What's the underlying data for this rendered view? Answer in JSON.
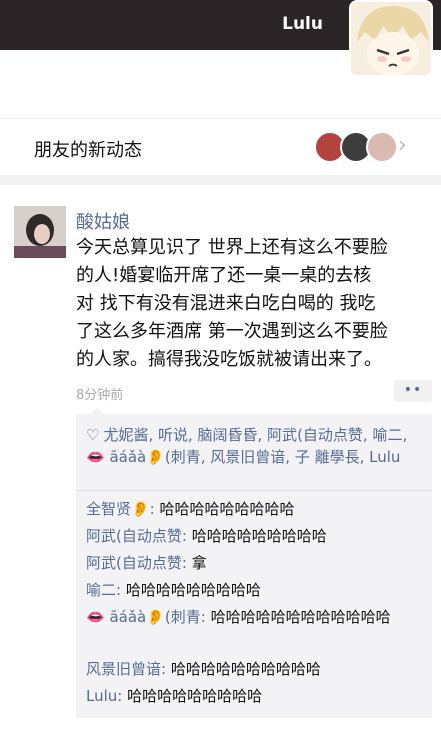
{
  "cover": {
    "name": "Lulu"
  },
  "updates_row": {
    "label": "朋友的新动态"
  },
  "post": {
    "author": "酸姑娘",
    "text": "今天总算见识了 世界上还有这么不要脸\n的人!婚宴临开席了还一桌一桌的去核\n对 找下有没有混进来白吃白喝的 我吃\n了这么多年酒席 第一次遇到这么不要脸\n的人家。搞得我没吃饭就被请出来了。",
    "time": "8分钟前",
    "more": "••"
  },
  "likes_text": "尤妮酱, 听说, 脑阔昏昏, 阿武(自动点赞, 喻二, 👄 āáǎà👂(刺青, 风景旧曾谙, 子 離學長, Lulu",
  "comments": [
    {
      "name": "全智贤👂:",
      "text": " 哈哈哈哈哈哈哈哈哈"
    },
    {
      "name": "阿武(自动点赞:",
      "text": " 哈哈哈哈哈哈哈哈哈"
    },
    {
      "name": "阿武(自动点赞:",
      "text": " 拿"
    },
    {
      "name": "喻二:",
      "text": " 哈哈哈哈哈哈哈哈哈"
    },
    {
      "name": "👄 āáǎà👂(刺青:",
      "text": " 哈哈哈哈哈哈哈哈哈哈哈哈"
    },
    {
      "name": "风景旧曾谙:",
      "text": " 哈哈哈哈哈哈哈哈哈哈"
    },
    {
      "name": "Lulu:",
      "text": " 哈哈哈哈哈哈哈哈哈"
    }
  ],
  "colors": {
    "link": "#576b95",
    "cover": "#2b2427"
  },
  "icons": {
    "likes": "heart-outline-icon",
    "chevron": "chevron-right-icon"
  }
}
